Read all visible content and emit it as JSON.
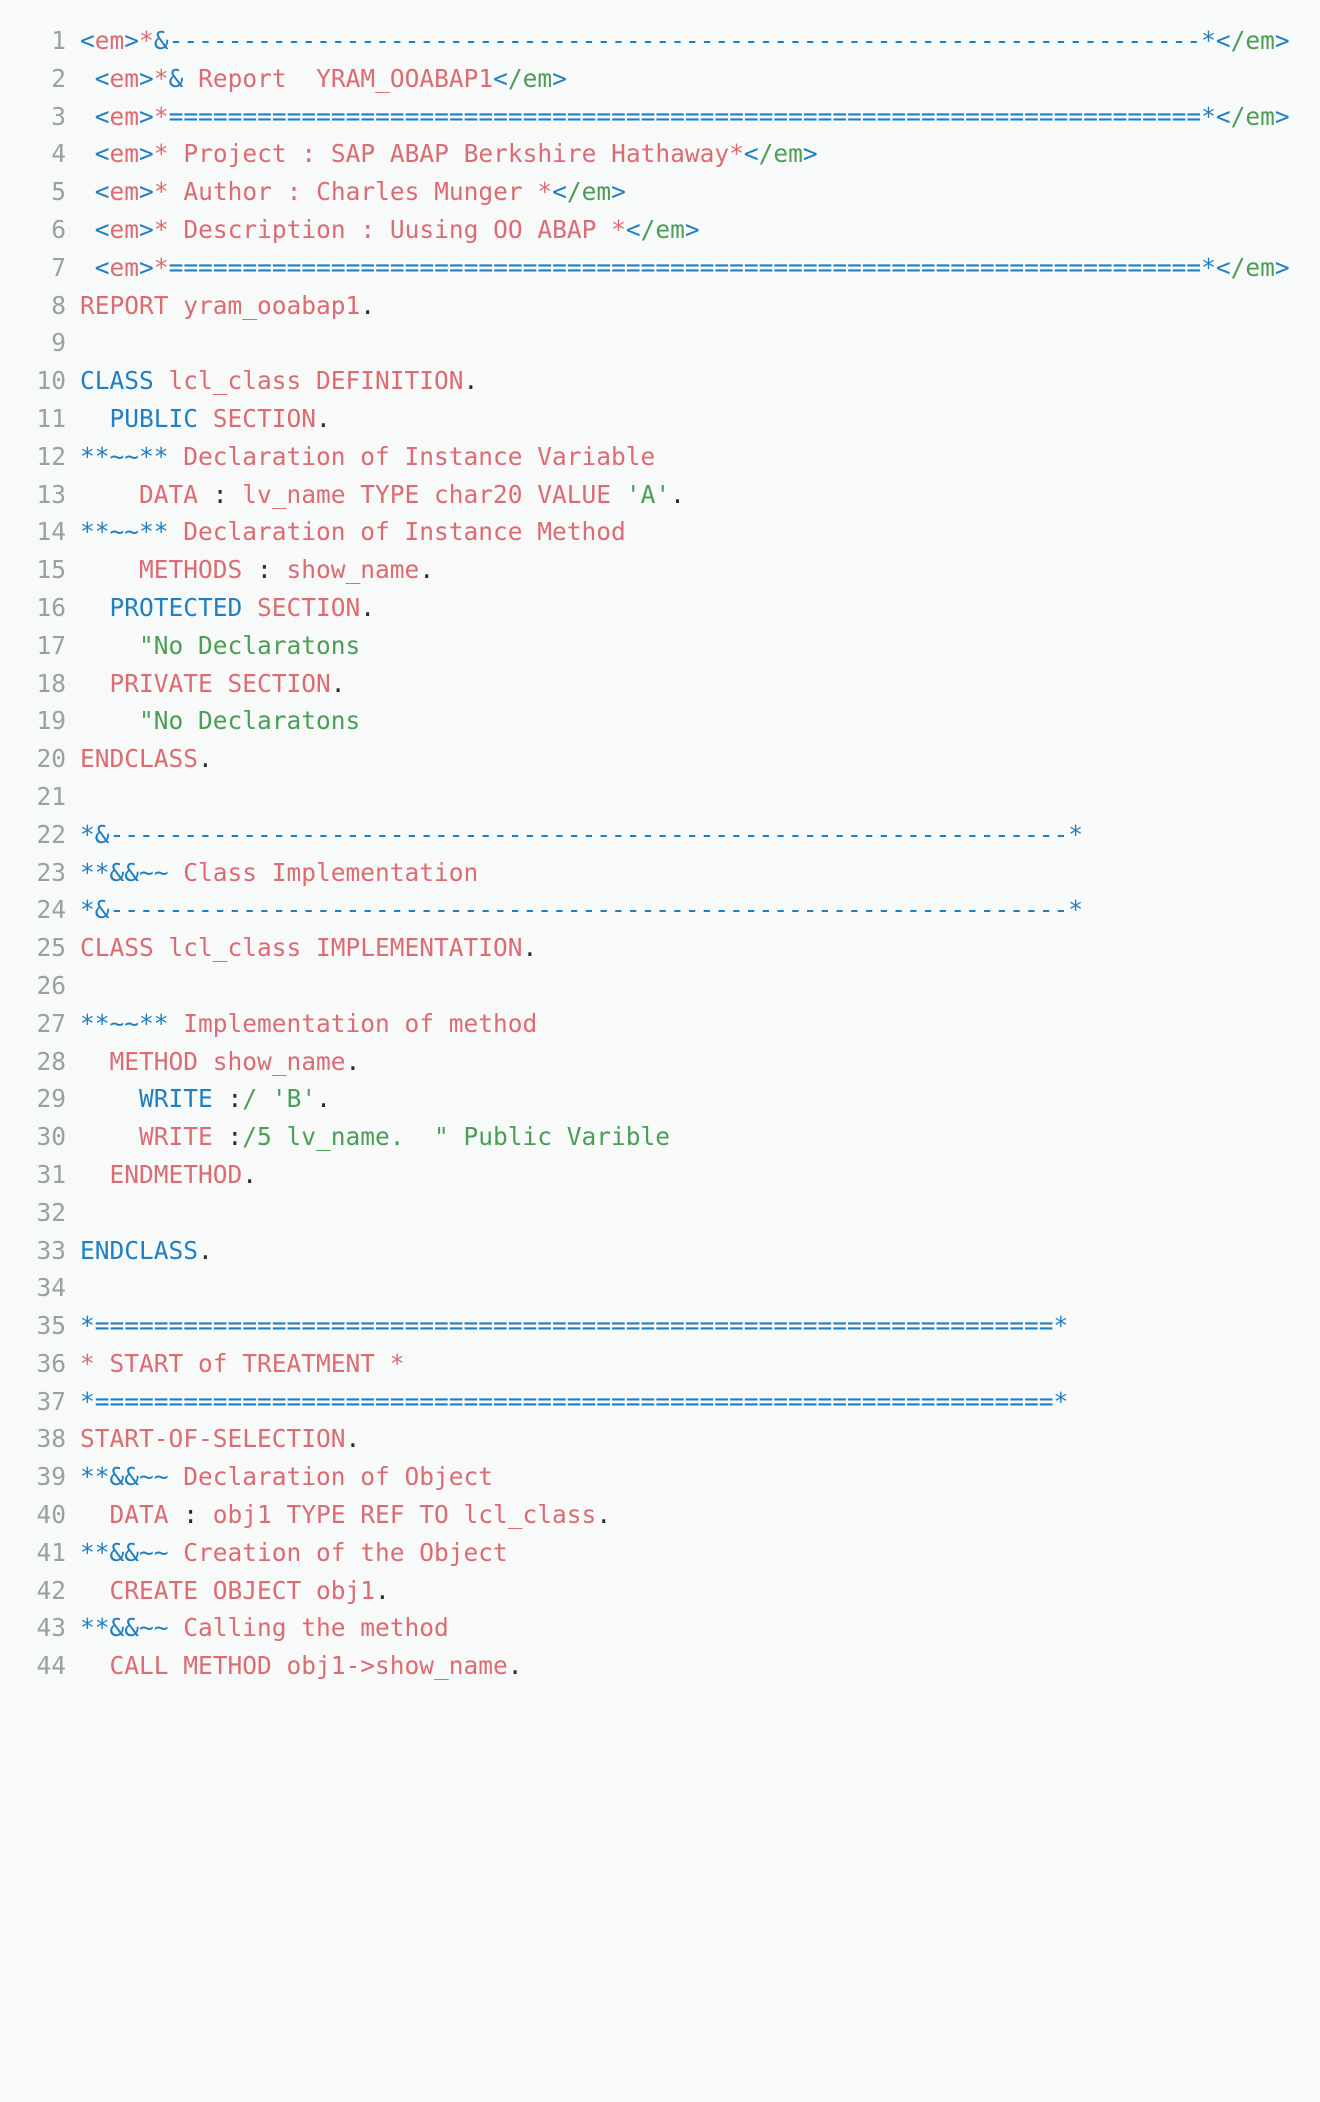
{
  "editor": {
    "background_color": "#f8f9f9",
    "line_number_color": "#9aa0a3",
    "language": "ABAP",
    "colors": {
      "keyword_blue": "#1f7fc4",
      "identifier_red": "#dd6b72",
      "string_green": "#4a9e55",
      "punctuation_dark": "#2b2b2b"
    }
  },
  "code": {
    "lines": [
      {
        "number": "1",
        "tokens": [
          {
            "t": "<",
            "c": "blue"
          },
          {
            "t": "em",
            "c": "red"
          },
          {
            "t": ">",
            "c": "blue"
          },
          {
            "t": "*",
            "c": "red"
          },
          {
            "t": "&-----------------------------------------------------------------",
            "c": "blue"
          },
          {
            "t": "-----*",
            "c": "blue"
          },
          {
            "t": "<",
            "c": "blue"
          },
          {
            "t": "/em",
            "c": "grn"
          },
          {
            "t": ">",
            "c": "blue"
          }
        ]
      },
      {
        "number": "2",
        "tokens": [
          {
            "t": " ",
            "c": "dark"
          },
          {
            "t": "<",
            "c": "blue"
          },
          {
            "t": "em",
            "c": "red"
          },
          {
            "t": ">",
            "c": "blue"
          },
          {
            "t": "*",
            "c": "red"
          },
          {
            "t": "&",
            "c": "blue"
          },
          {
            "t": " Report  YRAM_OOABAP1",
            "c": "red"
          },
          {
            "t": "<",
            "c": "blue"
          },
          {
            "t": "/em",
            "c": "grn"
          },
          {
            "t": ">",
            "c": "blue"
          }
        ]
      },
      {
        "number": "3",
        "tokens": [
          {
            "t": " ",
            "c": "dark"
          },
          {
            "t": "<",
            "c": "blue"
          },
          {
            "t": "em",
            "c": "red"
          },
          {
            "t": ">",
            "c": "blue"
          },
          {
            "t": "*",
            "c": "red"
          },
          {
            "t": "================================================================",
            "c": "blue"
          },
          {
            "t": "======*",
            "c": "blue"
          },
          {
            "t": "<",
            "c": "blue"
          },
          {
            "t": "/em",
            "c": "grn"
          },
          {
            "t": ">",
            "c": "blue"
          }
        ]
      },
      {
        "number": "4",
        "tokens": [
          {
            "t": " ",
            "c": "dark"
          },
          {
            "t": "<",
            "c": "blue"
          },
          {
            "t": "em",
            "c": "red"
          },
          {
            "t": ">",
            "c": "blue"
          },
          {
            "t": "* Project : SAP ABAP Berkshire Hathaway*",
            "c": "red"
          },
          {
            "t": "<",
            "c": "blue"
          },
          {
            "t": "/em",
            "c": "grn"
          },
          {
            "t": ">",
            "c": "blue"
          }
        ]
      },
      {
        "number": "5",
        "tokens": [
          {
            "t": " ",
            "c": "dark"
          },
          {
            "t": "<",
            "c": "blue"
          },
          {
            "t": "em",
            "c": "red"
          },
          {
            "t": ">",
            "c": "blue"
          },
          {
            "t": "* Author : Charles Munger *",
            "c": "red"
          },
          {
            "t": "<",
            "c": "blue"
          },
          {
            "t": "/em",
            "c": "grn"
          },
          {
            "t": ">",
            "c": "blue"
          }
        ]
      },
      {
        "number": "6",
        "tokens": [
          {
            "t": " ",
            "c": "dark"
          },
          {
            "t": "<",
            "c": "blue"
          },
          {
            "t": "em",
            "c": "red"
          },
          {
            "t": ">",
            "c": "blue"
          },
          {
            "t": "* Description : Uusing OO ABAP *",
            "c": "red"
          },
          {
            "t": "<",
            "c": "blue"
          },
          {
            "t": "/em",
            "c": "grn"
          },
          {
            "t": ">",
            "c": "blue"
          }
        ]
      },
      {
        "number": "7",
        "tokens": [
          {
            "t": " ",
            "c": "dark"
          },
          {
            "t": "<",
            "c": "blue"
          },
          {
            "t": "em",
            "c": "red"
          },
          {
            "t": ">",
            "c": "blue"
          },
          {
            "t": "*",
            "c": "red"
          },
          {
            "t": "================================================================",
            "c": "blue"
          },
          {
            "t": "======*",
            "c": "blue"
          },
          {
            "t": "<",
            "c": "blue"
          },
          {
            "t": "/em",
            "c": "grn"
          },
          {
            "t": ">",
            "c": "blue"
          }
        ]
      },
      {
        "number": "8",
        "tokens": [
          {
            "t": "REPORT yram_ooabap1",
            "c": "red"
          },
          {
            "t": ".",
            "c": "dark"
          }
        ]
      },
      {
        "number": "9",
        "tokens": []
      },
      {
        "number": "10",
        "tokens": [
          {
            "t": "CLASS",
            "c": "blue"
          },
          {
            "t": " lcl_class DEFINITION",
            "c": "red"
          },
          {
            "t": ".",
            "c": "dark"
          }
        ]
      },
      {
        "number": "11",
        "tokens": [
          {
            "t": "  ",
            "c": "dark"
          },
          {
            "t": "PUBLIC",
            "c": "blue"
          },
          {
            "t": " SECTION",
            "c": "red"
          },
          {
            "t": ".",
            "c": "dark"
          }
        ]
      },
      {
        "number": "12",
        "tokens": [
          {
            "t": "**~~**",
            "c": "blue"
          },
          {
            "t": " Declaration of Instance Variable",
            "c": "red"
          }
        ]
      },
      {
        "number": "13",
        "tokens": [
          {
            "t": "    DATA ",
            "c": "red"
          },
          {
            "t": ":",
            "c": "dark"
          },
          {
            "t": " lv_name TYPE char20 VALUE ",
            "c": "red"
          },
          {
            "t": "'A'",
            "c": "grn"
          },
          {
            "t": ".",
            "c": "dark"
          }
        ]
      },
      {
        "number": "14",
        "tokens": [
          {
            "t": "**~~**",
            "c": "blue"
          },
          {
            "t": " Declaration of Instance Method",
            "c": "red"
          }
        ]
      },
      {
        "number": "15",
        "tokens": [
          {
            "t": "    METHODS ",
            "c": "red"
          },
          {
            "t": ":",
            "c": "dark"
          },
          {
            "t": " show_name",
            "c": "red"
          },
          {
            "t": ".",
            "c": "dark"
          }
        ]
      },
      {
        "number": "16",
        "tokens": [
          {
            "t": "  ",
            "c": "dark"
          },
          {
            "t": "PROTECTED",
            "c": "blue"
          },
          {
            "t": " SECTION",
            "c": "red"
          },
          {
            "t": ".",
            "c": "dark"
          }
        ]
      },
      {
        "number": "17",
        "tokens": [
          {
            "t": "    ",
            "c": "dark"
          },
          {
            "t": "\"No Declaratons",
            "c": "grn"
          }
        ]
      },
      {
        "number": "18",
        "tokens": [
          {
            "t": "  PRIVATE SECTION",
            "c": "red"
          },
          {
            "t": ".",
            "c": "dark"
          }
        ]
      },
      {
        "number": "19",
        "tokens": [
          {
            "t": "    ",
            "c": "dark"
          },
          {
            "t": "\"No Declaratons",
            "c": "grn"
          }
        ]
      },
      {
        "number": "20",
        "tokens": [
          {
            "t": "ENDCLASS",
            "c": "red"
          },
          {
            "t": ".",
            "c": "dark"
          }
        ]
      },
      {
        "number": "21",
        "tokens": []
      },
      {
        "number": "22",
        "tokens": [
          {
            "t": "*&----------------------------------------------------------------",
            "c": "blue"
          },
          {
            "t": "-*",
            "c": "blue"
          }
        ]
      },
      {
        "number": "23",
        "tokens": [
          {
            "t": "**&&~~",
            "c": "blue"
          },
          {
            "t": " Class Implementation",
            "c": "red"
          }
        ]
      },
      {
        "number": "24",
        "tokens": [
          {
            "t": "*&----------------------------------------------------------------",
            "c": "blue"
          },
          {
            "t": "-*",
            "c": "blue"
          }
        ]
      },
      {
        "number": "25",
        "tokens": [
          {
            "t": "CLASS lcl_class IMPLEMENTATION",
            "c": "red"
          },
          {
            "t": ".",
            "c": "dark"
          }
        ]
      },
      {
        "number": "26",
        "tokens": []
      },
      {
        "number": "27",
        "tokens": [
          {
            "t": "**~~**",
            "c": "blue"
          },
          {
            "t": " Implementation of method",
            "c": "red"
          }
        ]
      },
      {
        "number": "28",
        "tokens": [
          {
            "t": "  METHOD show_name",
            "c": "red"
          },
          {
            "t": ".",
            "c": "dark"
          }
        ]
      },
      {
        "number": "29",
        "tokens": [
          {
            "t": "    ",
            "c": "dark"
          },
          {
            "t": "WRITE",
            "c": "blue"
          },
          {
            "t": " ",
            "c": "dark"
          },
          {
            "t": ":",
            "c": "dark"
          },
          {
            "t": "/ ",
            "c": "grn"
          },
          {
            "t": "'B'",
            "c": "grn"
          },
          {
            "t": ".",
            "c": "dark"
          }
        ]
      },
      {
        "number": "30",
        "tokens": [
          {
            "t": "    WRITE ",
            "c": "red"
          },
          {
            "t": ":",
            "c": "dark"
          },
          {
            "t": "/5 lv_name.  \" Public Varible",
            "c": "grn"
          }
        ]
      },
      {
        "number": "31",
        "tokens": [
          {
            "t": "  ENDMETHOD",
            "c": "red"
          },
          {
            "t": ".",
            "c": "dark"
          }
        ]
      },
      {
        "number": "32",
        "tokens": []
      },
      {
        "number": "33",
        "tokens": [
          {
            "t": "ENDCLASS",
            "c": "blue"
          },
          {
            "t": ".",
            "c": "dark"
          }
        ]
      },
      {
        "number": "34",
        "tokens": []
      },
      {
        "number": "35",
        "tokens": [
          {
            "t": "*================================================================",
            "c": "blue"
          },
          {
            "t": "=*",
            "c": "blue"
          }
        ]
      },
      {
        "number": "36",
        "tokens": [
          {
            "t": "* START of TREATMENT *",
            "c": "red"
          }
        ]
      },
      {
        "number": "37",
        "tokens": [
          {
            "t": "*================================================================",
            "c": "blue"
          },
          {
            "t": "=*",
            "c": "blue"
          }
        ]
      },
      {
        "number": "38",
        "tokens": [
          {
            "t": "START-OF-SELECTION",
            "c": "red"
          },
          {
            "t": ".",
            "c": "dark"
          }
        ]
      },
      {
        "number": "39",
        "tokens": [
          {
            "t": "**&&~~",
            "c": "blue"
          },
          {
            "t": " Declaration of Object",
            "c": "red"
          }
        ]
      },
      {
        "number": "40",
        "tokens": [
          {
            "t": "  DATA ",
            "c": "red"
          },
          {
            "t": ":",
            "c": "dark"
          },
          {
            "t": " obj1 TYPE REF TO lcl_class",
            "c": "red"
          },
          {
            "t": ".",
            "c": "dark"
          }
        ]
      },
      {
        "number": "41",
        "tokens": [
          {
            "t": "**&&~~",
            "c": "blue"
          },
          {
            "t": " Creation of the Object",
            "c": "red"
          }
        ]
      },
      {
        "number": "42",
        "tokens": [
          {
            "t": "  CREATE OBJECT obj1",
            "c": "red"
          },
          {
            "t": ".",
            "c": "dark"
          }
        ]
      },
      {
        "number": "43",
        "tokens": [
          {
            "t": "**&&~~",
            "c": "blue"
          },
          {
            "t": " Calling the method",
            "c": "red"
          }
        ]
      },
      {
        "number": "44",
        "tokens": [
          {
            "t": "  CALL METHOD obj1->show_name",
            "c": "red"
          },
          {
            "t": ".",
            "c": "dark"
          }
        ]
      }
    ]
  }
}
